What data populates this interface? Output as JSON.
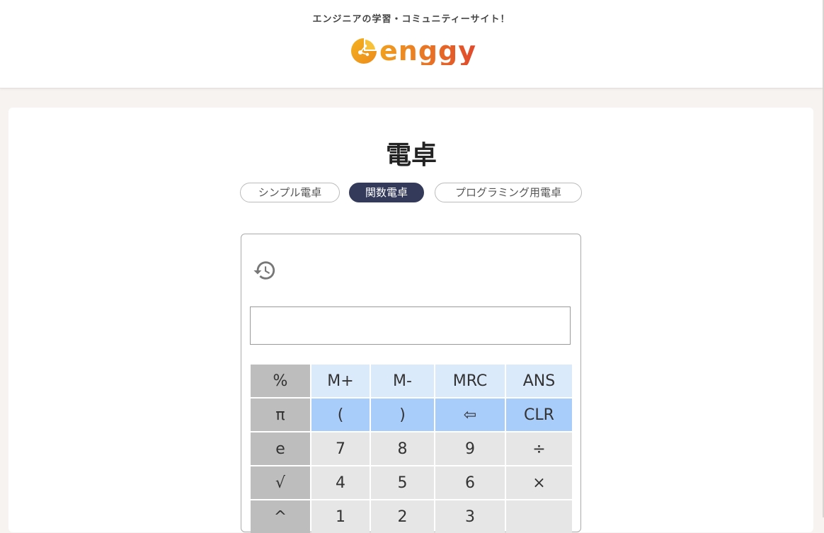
{
  "header": {
    "tagline": "エンジニアの学習・コミュニティーサイト！",
    "logo_text": "enggy",
    "logo_colors": [
      "#f0a020",
      "#e0482c"
    ]
  },
  "page": {
    "title": "電卓"
  },
  "tabs": [
    {
      "label": "シンプル電卓",
      "active": false
    },
    {
      "label": "関数電卓",
      "active": true
    },
    {
      "label": "プログラミング用電卓",
      "active": false
    }
  ],
  "calculator": {
    "history_icon": "history-icon",
    "display_value": "",
    "keys": [
      [
        "%",
        "M+",
        "M-",
        "MRC",
        "ANS"
      ],
      [
        "π",
        "(",
        ")",
        "⇦",
        "CLR"
      ],
      [
        "e",
        "7",
        "8",
        "9",
        "÷"
      ],
      [
        "√",
        "4",
        "5",
        "6",
        "×"
      ],
      [
        "^",
        "1",
        "2",
        "3",
        ""
      ]
    ]
  },
  "colors": {
    "accent": "#343a5a",
    "key_function": "#bdbdbd",
    "key_memory": "#dbeafb",
    "key_operator": "#a9cdfb",
    "key_number": "#e6e6e6"
  }
}
